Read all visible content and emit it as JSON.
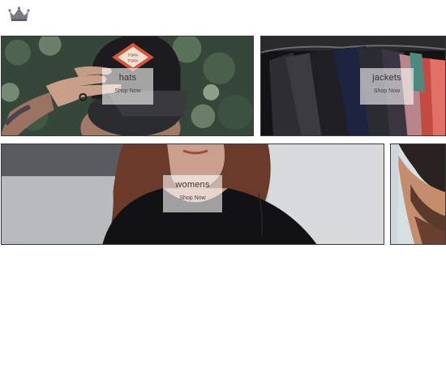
{
  "header": {
    "logo_icon": "crown-icon"
  },
  "categories": [
    {
      "title": "hats",
      "cta": "Shop Now"
    },
    {
      "title": "jackets",
      "cta": "Shop Now"
    },
    {
      "title": "womens",
      "cta": "Shop Now"
    }
  ],
  "hat_patch": {
    "line1": "TOPA",
    "line2": "TOPA"
  },
  "colors": {
    "card_background": "#ffffff",
    "text": "#333333",
    "tile_border": "#3a3a3a",
    "patch_red": "#d8543f"
  }
}
